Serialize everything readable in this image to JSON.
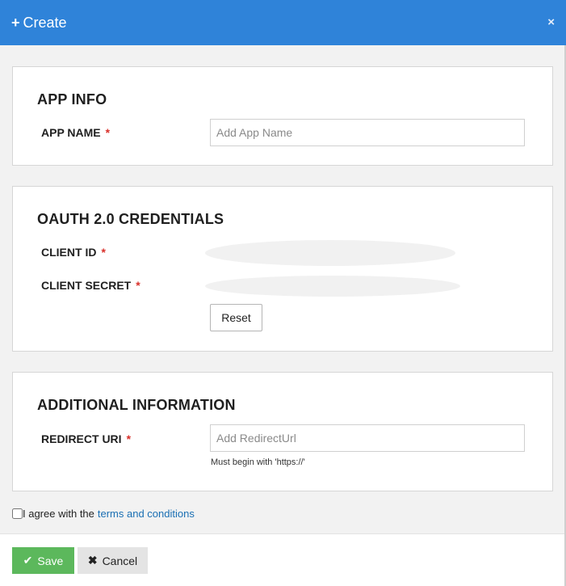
{
  "modal": {
    "title": "Create",
    "close_label": "×"
  },
  "app_info": {
    "section_title": "APP INFO",
    "app_name_label": "APP NAME",
    "app_name_placeholder": "Add App Name",
    "app_name_value": "",
    "required_mark": "*"
  },
  "oauth": {
    "section_title": "OAUTH 2.0 CREDENTIALS",
    "client_id_label": "CLIENT ID",
    "client_secret_label": "CLIENT SECRET",
    "required_mark": "*",
    "reset_label": "Reset"
  },
  "additional": {
    "section_title": "ADDITIONAL INFORMATION",
    "redirect_label": "REDIRECT URI",
    "redirect_placeholder": "Add RedirectUrl",
    "redirect_value": "",
    "required_mark": "*",
    "hint": "Must begin with 'https://'"
  },
  "agreement": {
    "prefix": "I agree with the",
    "link_text": "terms and conditions",
    "checked": false
  },
  "footer": {
    "save_label": "Save",
    "cancel_label": "Cancel"
  },
  "colors": {
    "header": "#2f83d9",
    "save": "#5cb85c",
    "required": "#d9302a",
    "link": "#1a6fb3"
  }
}
